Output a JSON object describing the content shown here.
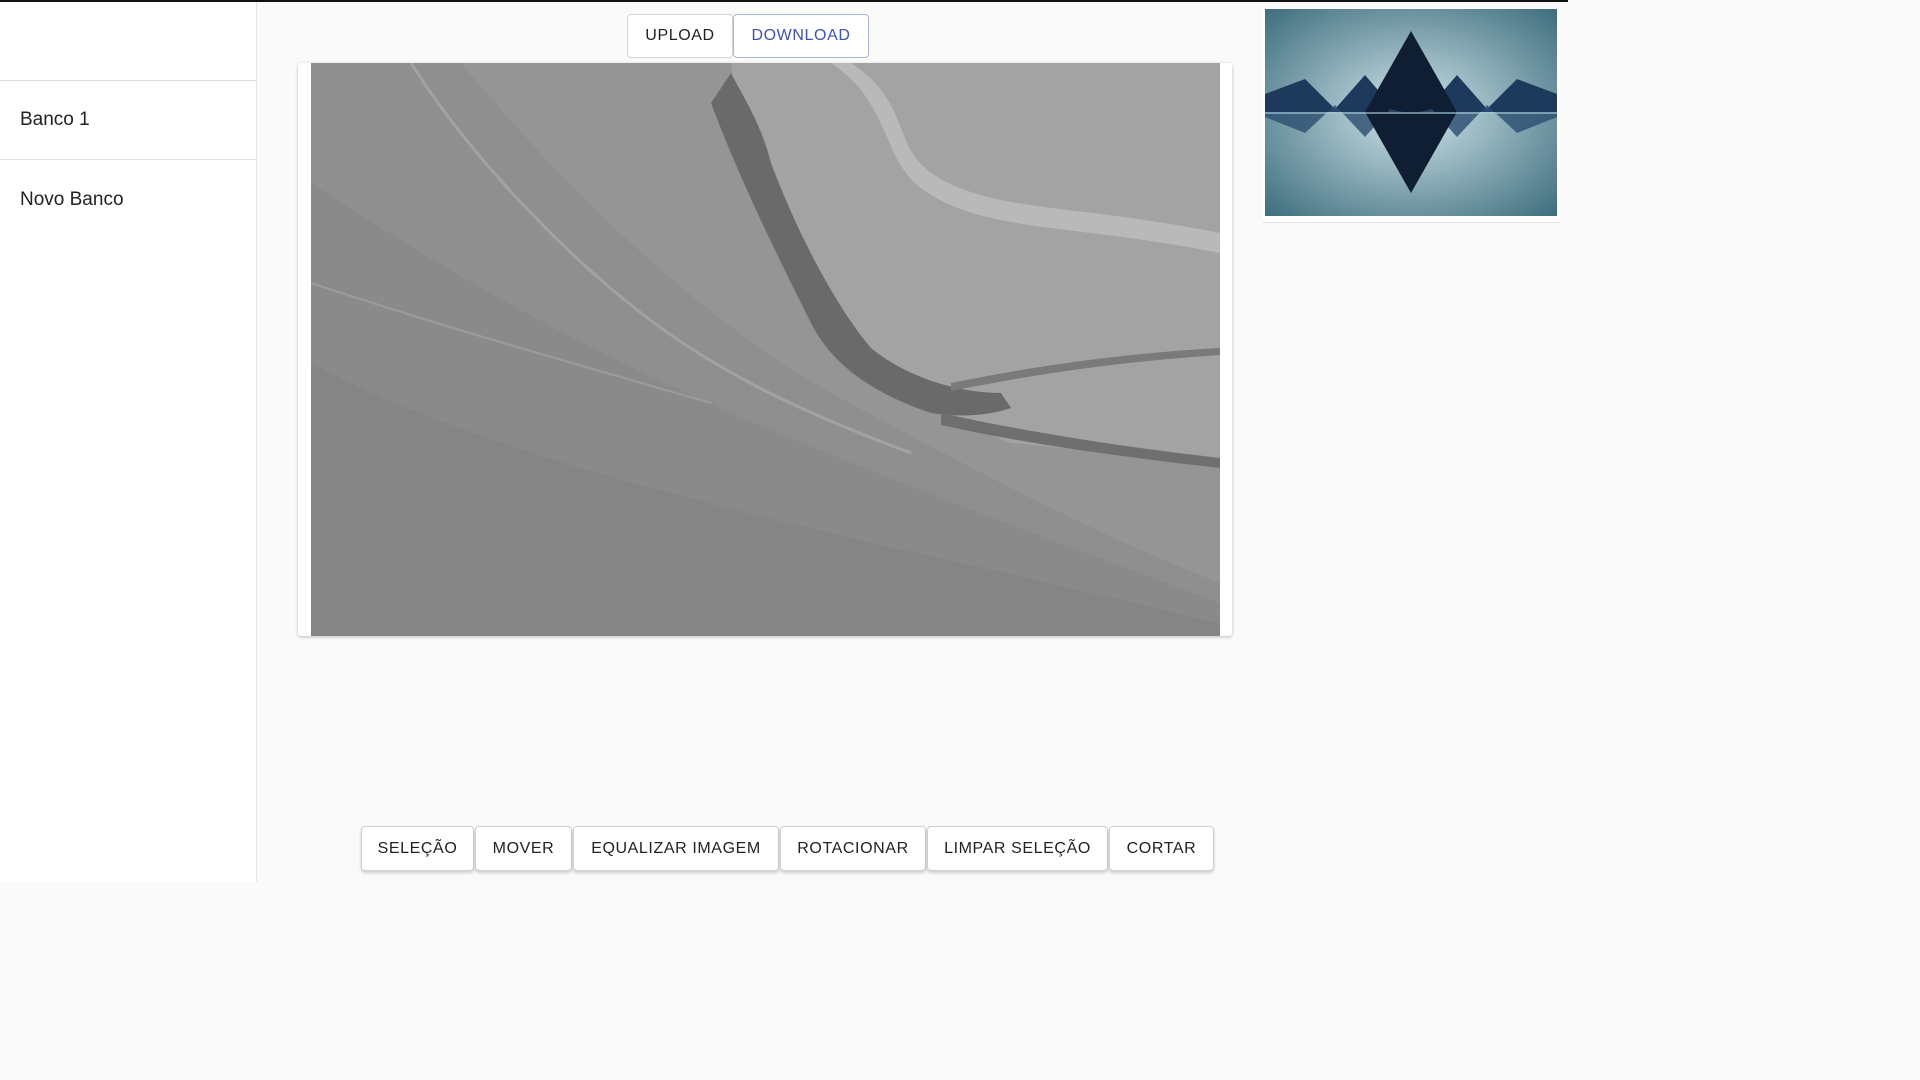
{
  "sidebar": {
    "items": [
      {
        "label": "Banco 1"
      },
      {
        "label": "Novo Banco"
      }
    ]
  },
  "toolbar_top": {
    "upload_label": "UPLOAD",
    "download_label": "DOWNLOAD"
  },
  "editor": {
    "image_description_icon": "landscape-image",
    "thumbnail_icon": "mountain-reflection-image"
  },
  "tools": {
    "selection_label": "SELEÇÃO",
    "move_label": "MOVER",
    "equalize_label": "EQUALIZAR IMAGEM",
    "rotate_label": "ROTACIONAR",
    "clear_selection_label": "LIMPAR SELEÇÃO",
    "crop_label": "CORTAR"
  },
  "colors": {
    "accent": "#3f51b5",
    "thumb_sky": "#5a8796",
    "thumb_mountain": "#0f1e33"
  }
}
